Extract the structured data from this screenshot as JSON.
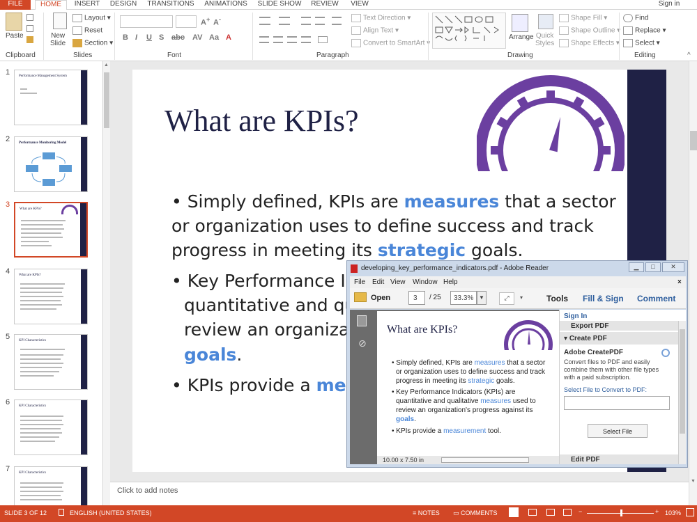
{
  "tabs": [
    "FILE",
    "HOME",
    "INSERT",
    "DESIGN",
    "TRANSITIONS",
    "ANIMATIONS",
    "SLIDE SHOW",
    "REVIEW",
    "VIEW"
  ],
  "signin": "Sign in",
  "ribbon": {
    "clipboard": {
      "label": "Clipboard",
      "paste": "Paste"
    },
    "slides": {
      "label": "Slides",
      "new_slide": "New\nSlide",
      "layout": "Layout",
      "reset": "Reset",
      "section": "Section"
    },
    "font": {
      "label": "Font"
    },
    "paragraph": {
      "label": "Paragraph",
      "text_direction": "Text Direction",
      "align_text": "Align Text",
      "convert_smartart": "Convert to SmartArt"
    },
    "drawing": {
      "label": "Drawing",
      "arrange": "Arrange",
      "quick_styles": "Quick\nStyles",
      "shape_fill": "Shape Fill",
      "shape_outline": "Shape Outline",
      "shape_effects": "Shape Effects"
    },
    "editing": {
      "label": "Editing",
      "find": "Find",
      "replace": "Replace",
      "select": "Select"
    }
  },
  "thumbnails": [
    {
      "num": "1",
      "title": "Performance Management System"
    },
    {
      "num": "2",
      "title": "Performance Monitoring Model"
    },
    {
      "num": "3",
      "title": "What are KPIs?"
    },
    {
      "num": "4",
      "title": "What are KPIs?"
    },
    {
      "num": "5",
      "title": "KPI Characteristics"
    },
    {
      "num": "6",
      "title": "KPI Characteristics"
    },
    {
      "num": "7",
      "title": "KPI Characteristics"
    }
  ],
  "slide": {
    "title": "What are KPIs?",
    "b1_l1a": "• Simply defined, KPIs are ",
    "b1_l1b": "measures",
    "b1_l1c": " that a sector",
    "b1_l2": "or organization uses to define success and track",
    "b1_l3a": "progress in meeting its ",
    "b1_l3b": "strategic",
    "b1_l3c": " goals.",
    "b2_l1": "• Key Performance In",
    "b2_l2": "quantitative and qu",
    "b2_l3": "review an organizat",
    "b2_l4": "goals",
    "b2_l4b": ".",
    "b3a": "• KPIs provide a ",
    "b3b": "meas"
  },
  "notes_placeholder": "Click to add notes",
  "status": {
    "slide": "SLIDE 3 OF 12",
    "lang": "ENGLISH (UNITED STATES)",
    "notes": "NOTES",
    "comments": "COMMENTS",
    "zoom": "103%"
  },
  "reader": {
    "title": "developing_key_performance_indicators.pdf - Adobe Reader",
    "menu": [
      "File",
      "Edit",
      "View",
      "Window",
      "Help"
    ],
    "open": "Open",
    "page": "3",
    "pages": "/ 25",
    "zoom": "33.3%",
    "tools": "Tools",
    "fill_sign": "Fill & Sign",
    "comment": "Comment",
    "signin": "Sign In",
    "export_pdf": "Export PDF",
    "create_pdf": "Create PDF",
    "createpdf_title": "Adobe CreatePDF",
    "createpdf_desc1": "Convert files to PDF and easily",
    "createpdf_desc2": "combine them with other file types",
    "createpdf_desc3": "with a paid subscription.",
    "select_label": "Select File to Convert to PDF:",
    "select_file": "Select File",
    "edit_pdf": "Edit PDF",
    "page_size": "10.00 x 7.50 in",
    "doc_title": "What are KPIs?",
    "d1": "• Simply defined, KPIs are ",
    "d1b": "measures",
    "d1c": " that a sector",
    "d2": "or organization uses to define success and track",
    "d3": "progress in meeting its ",
    "d3b": "strategic",
    "d3c": " goals.",
    "d4": "• Key Performance Indicators (KPIs) are",
    "d5": "quantitative and qualitative ",
    "d5b": "measures",
    "d5c": " used to",
    "d6": "review an organization's progress against its",
    "d7": "goals",
    "d7b": ".",
    "d8": "• KPIs provide a ",
    "d8b": "measurement",
    "d8c": " tool."
  },
  "colors": {
    "accent": "#d24726",
    "navy": "#1f2145",
    "highlight": "#4a86d8",
    "purple": "#6b3fa0"
  }
}
